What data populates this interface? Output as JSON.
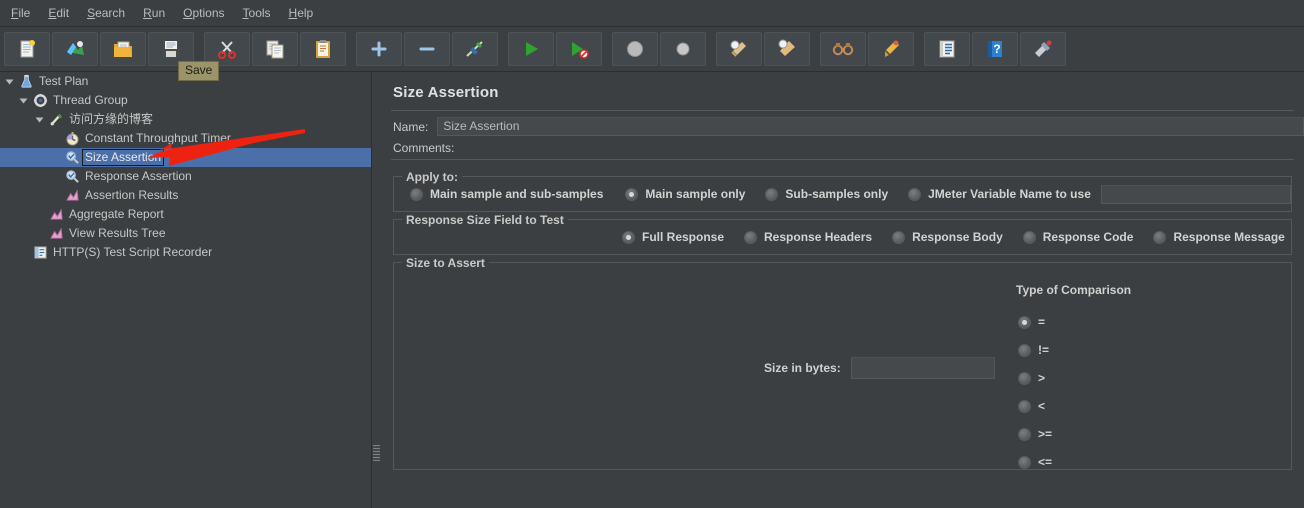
{
  "menu": {
    "items": [
      {
        "label": "File",
        "mnemonic": "F"
      },
      {
        "label": "Edit",
        "mnemonic": "E"
      },
      {
        "label": "Search",
        "mnemonic": "S"
      },
      {
        "label": "Run",
        "mnemonic": "R"
      },
      {
        "label": "Options",
        "mnemonic": "O"
      },
      {
        "label": "Tools",
        "mnemonic": "T"
      },
      {
        "label": "Help",
        "mnemonic": "H"
      }
    ]
  },
  "toolbar": {
    "buttons": [
      {
        "name": "new-button",
        "icon": "new-document-icon"
      },
      {
        "name": "templates-button",
        "icon": "templates-icon"
      },
      {
        "name": "open-button",
        "icon": "open-folder-icon"
      },
      {
        "name": "save-button",
        "icon": "save-floppy-icon"
      },
      {
        "name": "cut-button",
        "icon": "scissors-icon"
      },
      {
        "name": "copy-button",
        "icon": "copy-icon"
      },
      {
        "name": "paste-button",
        "icon": "clipboard-paste-icon"
      },
      {
        "name": "expand-all-button",
        "icon": "plus-icon"
      },
      {
        "name": "collapse-all-button",
        "icon": "minus-icon"
      },
      {
        "name": "toggle-button",
        "icon": "toggle-pin-icon"
      },
      {
        "name": "start-button",
        "icon": "play-green-icon"
      },
      {
        "name": "start-no-pauses-button",
        "icon": "play-no-pause-icon"
      },
      {
        "name": "stop-button",
        "icon": "stop-circle-icon"
      },
      {
        "name": "shutdown-button",
        "icon": "shutdown-circle-icon"
      },
      {
        "name": "clear-button",
        "icon": "clear-broom-icon"
      },
      {
        "name": "clear-all-button",
        "icon": "clear-all-broom-icon"
      },
      {
        "name": "search-button",
        "icon": "binoculars-icon"
      },
      {
        "name": "reset-search-button",
        "icon": "reset-search-icon"
      },
      {
        "name": "function-helper-button",
        "icon": "function-helper-icon"
      },
      {
        "name": "help-button",
        "icon": "help-book-icon"
      },
      {
        "name": "undo-redo-button",
        "icon": "undo-redo-icon"
      }
    ],
    "tooltip": "Save"
  },
  "tree": {
    "nodes": [
      {
        "label": "Test Plan",
        "icon": "test-plan-icon",
        "depth": 0,
        "expanded": true,
        "selected": false
      },
      {
        "label": "Thread Group",
        "icon": "thread-group-icon",
        "depth": 1,
        "expanded": true,
        "selected": false
      },
      {
        "label": "访问方缘的博客",
        "icon": "http-sampler-icon",
        "depth": 2,
        "expanded": true,
        "selected": false
      },
      {
        "label": "Constant Throughput Timer",
        "icon": "timer-icon",
        "depth": 3,
        "expanded": false,
        "selected": false
      },
      {
        "label": "Size Assertion",
        "icon": "assertion-icon",
        "depth": 3,
        "expanded": false,
        "selected": true
      },
      {
        "label": "Response Assertion",
        "icon": "assertion-icon",
        "depth": 3,
        "expanded": false,
        "selected": false
      },
      {
        "label": "Assertion Results",
        "icon": "listener-icon",
        "depth": 3,
        "expanded": false,
        "selected": false
      },
      {
        "label": "Aggregate Report",
        "icon": "listener-icon",
        "depth": 2,
        "expanded": false,
        "selected": false
      },
      {
        "label": "View Results Tree",
        "icon": "listener-icon",
        "depth": 2,
        "expanded": false,
        "selected": false
      },
      {
        "label": "HTTP(S) Test Script Recorder",
        "icon": "recorder-icon",
        "depth": 1,
        "expanded": false,
        "selected": false
      }
    ]
  },
  "panel": {
    "title": "Size Assertion",
    "name_label": "Name:",
    "name_value": "Size Assertion",
    "comments_label": "Comments:",
    "comments_value": "",
    "apply_to": {
      "legend": "Apply to:",
      "options": [
        {
          "label": "Main sample and sub-samples",
          "selected": false
        },
        {
          "label": "Main sample only",
          "selected": true
        },
        {
          "label": "Sub-samples only",
          "selected": false
        },
        {
          "label": "JMeter Variable Name to use",
          "selected": false
        }
      ],
      "variable_value": ""
    },
    "response_field": {
      "legend": "Response Size Field to Test",
      "options": [
        {
          "label": "Full Response",
          "selected": true
        },
        {
          "label": "Response Headers",
          "selected": false
        },
        {
          "label": "Response Body",
          "selected": false
        },
        {
          "label": "Response Code",
          "selected": false
        },
        {
          "label": "Response Message",
          "selected": false
        }
      ]
    },
    "size_to_assert": {
      "legend": "Size to Assert",
      "size_label": "Size in bytes:",
      "size_value": "",
      "comparison_title": "Type of Comparison",
      "comparisons": [
        {
          "label": "=",
          "selected": true
        },
        {
          "label": "!=",
          "selected": false
        },
        {
          "label": ">",
          "selected": false
        },
        {
          "label": "<",
          "selected": false
        },
        {
          "label": ">=",
          "selected": false
        },
        {
          "label": "<=",
          "selected": false
        }
      ]
    }
  },
  "annotation": {
    "arrow_color": "#ee2211"
  }
}
